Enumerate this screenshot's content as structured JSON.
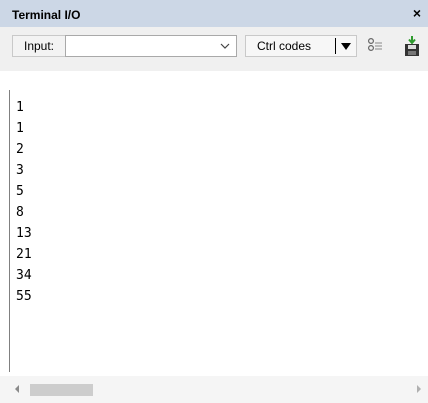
{
  "window": {
    "title": "Terminal I/O",
    "close_glyph": "×"
  },
  "toolbar": {
    "input_label": "Input:",
    "input_value": "",
    "input_placeholder": "",
    "ctrl_codes_label": "Ctrl codes",
    "icons": [
      "settings-icon",
      "save-icon"
    ]
  },
  "output": {
    "lines": [
      "1",
      "1",
      "2",
      "3",
      "5",
      "8",
      "13",
      "21",
      "34",
      "55"
    ]
  },
  "colors": {
    "titlebar": "#ccd7e6",
    "save_icon_green": "#2e9b2e"
  }
}
